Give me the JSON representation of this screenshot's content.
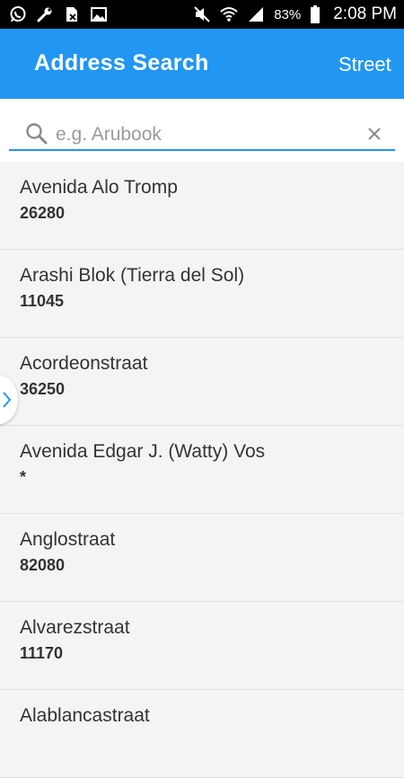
{
  "status_bar": {
    "battery_percent": "83%",
    "time": "2:08 PM",
    "icons": [
      "whatsapp-icon",
      "wrench-icon",
      "no-sim-icon",
      "image-icon",
      "mute-icon",
      "wifi-icon",
      "signal-icon",
      "battery-icon"
    ]
  },
  "header": {
    "title": "Address Search",
    "tab_label": "Street"
  },
  "search": {
    "placeholder": "e.g. Arubook",
    "value": ""
  },
  "results": [
    {
      "name": "Avenida Alo Tromp",
      "code": "26280"
    },
    {
      "name": "Arashi Blok (Tierra del Sol)",
      "code": "11045"
    },
    {
      "name": "Acordeonstraat",
      "code": "36250"
    },
    {
      "name": "Avenida Edgar J. (Watty) Vos",
      "code": "*"
    },
    {
      "name": "Anglostraat",
      "code": "82080"
    },
    {
      "name": "Alvarezstraat",
      "code": "11170"
    },
    {
      "name": "Alablancastraat",
      "code": ""
    }
  ],
  "colors": {
    "app_bar": "#2196f3",
    "status_bar": "#000000",
    "list_background": "#f4f4f4"
  }
}
